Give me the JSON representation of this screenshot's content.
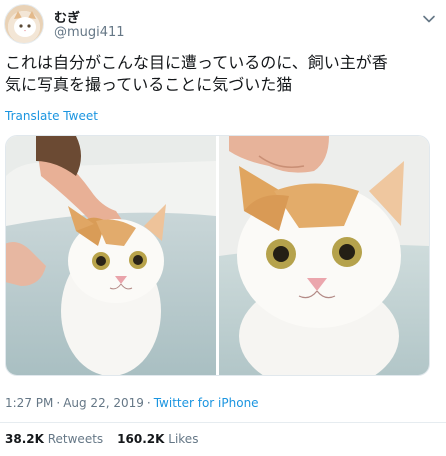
{
  "user": {
    "display_name": "むぎ",
    "handle": "@mugi411",
    "avatar_icon": "cat-avatar-icon"
  },
  "tweet": {
    "text_lines": [
      "これは自分がこんな目に遭っているのに、飼い主が香",
      "気に写真を撮っていることに気づいた猫"
    ],
    "translate_label": "Translate Tweet"
  },
  "meta": {
    "time": "1:27 PM",
    "separator": "·",
    "date": "Aug 22, 2019",
    "source": "Twitter for iPhone"
  },
  "stats": {
    "retweets_count": "38.2K",
    "retweets_label": "Retweets",
    "likes_count": "160.2K",
    "likes_label": "Likes"
  },
  "colors": {
    "link": "#1b95e0",
    "secondary_text": "#657786",
    "primary_text": "#14171a",
    "divider": "#e6ecf0"
  }
}
